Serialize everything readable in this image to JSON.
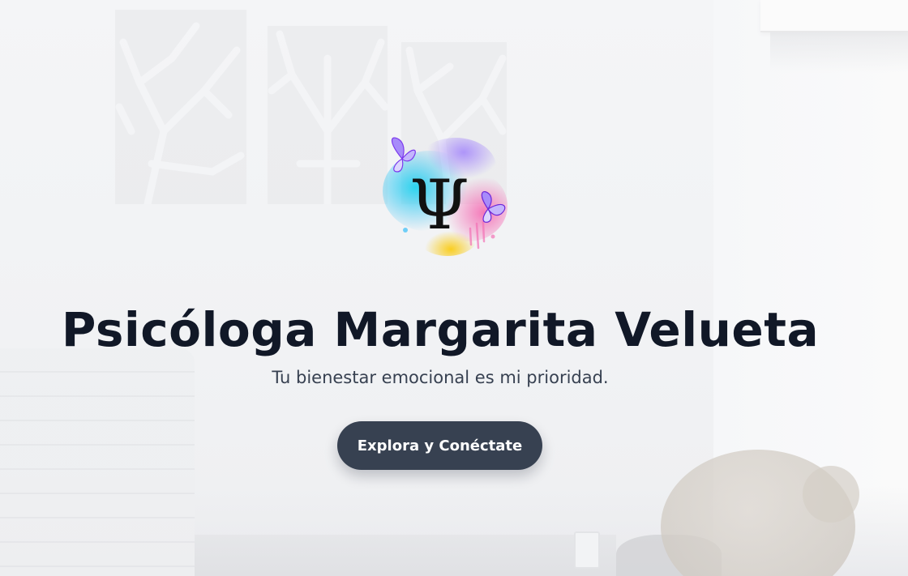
{
  "hero": {
    "title": "Psicóloga Margarita Velueta",
    "subtitle": "Tu bienestar emocional es mi prioridad.",
    "cta_label": "Explora y Conéctate",
    "logo": {
      "glyph": "Ψ",
      "icon": "psi-watercolor-butterfly-logo"
    }
  },
  "colors": {
    "title": "#111827",
    "subtitle": "#374151",
    "button_bg": "#374151",
    "button_text": "#ffffff",
    "background": "#f3f4f6"
  }
}
